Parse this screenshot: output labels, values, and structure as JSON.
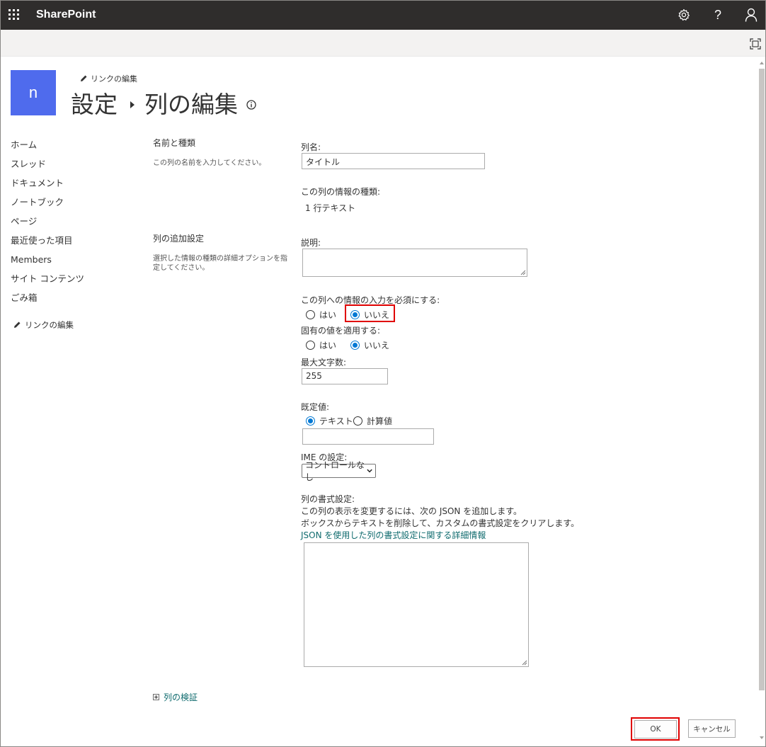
{
  "suitebar": {
    "brand": "SharePoint"
  },
  "header": {
    "logo_letter": "n",
    "edit_links": "リンクの編集",
    "title_parent": "設定",
    "title_current": "列の編集"
  },
  "nav": {
    "items": [
      "ホーム",
      "スレッド",
      "ドキュメント",
      "ノートブック",
      "ページ",
      "最近使った項目",
      "Members",
      "サイト コンテンツ",
      "ごみ箱"
    ],
    "edit_links": "リンクの編集"
  },
  "sections": {
    "name_type": {
      "title": "名前と種類",
      "description": "この列の名前を入力してください。"
    },
    "additional": {
      "title": "列の追加設定",
      "description": "選択した情報の種類の詳細オプションを指定してください。"
    }
  },
  "form": {
    "column_name_label": "列名:",
    "column_name_value": "タイトル",
    "type_label": "この列の情報の種類:",
    "type_value": "1 行テキスト",
    "description_label": "説明:",
    "required_label": "この列への情報の入力を必須にする:",
    "required_options": [
      "はい",
      "いいえ"
    ],
    "required_selected": "いいえ",
    "unique_label": "固有の値を適用する:",
    "unique_options": [
      "はい",
      "いいえ"
    ],
    "unique_selected": "いいえ",
    "max_length_label": "最大文字数:",
    "max_length_value": "255",
    "default_label": "既定値:",
    "default_options": [
      "テキスト",
      "計算値"
    ],
    "default_selected": "テキスト",
    "default_value": "",
    "ime_label": "IME の設定:",
    "ime_value": "コントロールなし",
    "formatting_label": "列の書式設定:",
    "formatting_desc1": "この列の表示を変更するには、次の JSON を追加します。",
    "formatting_desc2": "ボックスからテキストを削除して、カスタムの書式設定をクリアします。",
    "formatting_link": "JSON を使用した列の書式設定に関する詳細情報",
    "validation_label": "列の検証"
  },
  "buttons": {
    "ok": "OK",
    "cancel": "キャンセル"
  },
  "colors": {
    "suitebar": "#2f2d2c",
    "logo": "#4f6bed",
    "link": "#0f6b6e",
    "radio_selected": "#0078d4",
    "highlight": "#e00000"
  }
}
